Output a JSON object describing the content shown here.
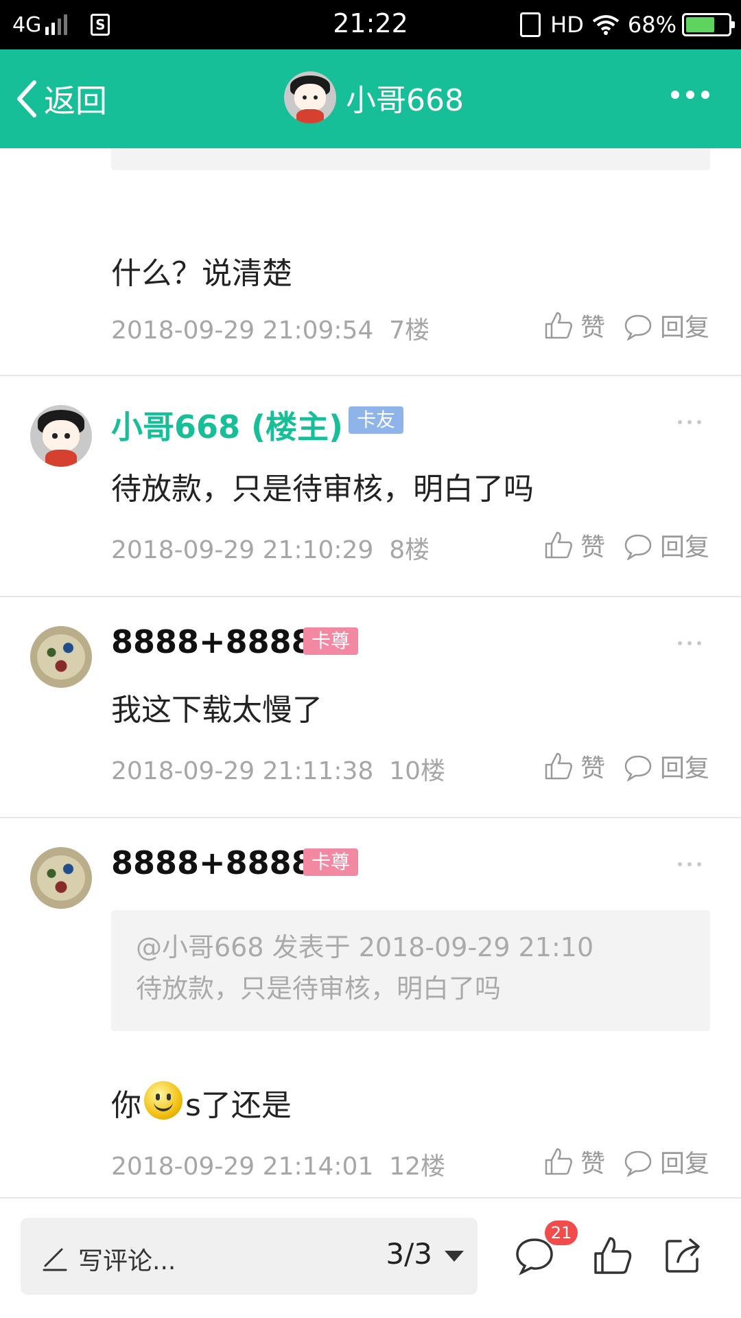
{
  "status_bar": {
    "network": "4G",
    "time": "21:22",
    "hd": "HD",
    "battery": "68%"
  },
  "header": {
    "back_label": "返回",
    "title": "小哥668"
  },
  "posts": [
    {
      "text": "什么？说清楚",
      "timestamp": "2018-09-29 21:09:54",
      "floor": "7楼",
      "like_label": "赞",
      "reply_label": "回复"
    },
    {
      "username": "小哥668 (楼主)",
      "badge": "卡友",
      "text": "待放款，只是待审核，明白了吗",
      "timestamp": "2018-09-29 21:10:29",
      "floor": "8楼",
      "like_label": "赞",
      "reply_label": "回复"
    },
    {
      "username": "8888+8888",
      "badge": "卡尊",
      "text": "我这下载太慢了",
      "timestamp": "2018-09-29 21:11:38",
      "floor": "10楼",
      "like_label": "赞",
      "reply_label": "回复"
    },
    {
      "username": "8888+8888",
      "badge": "卡尊",
      "quote_header": "@小哥668 发表于 2018-09-29 21:10",
      "quote_text": "待放款，只是待审核，明白了吗",
      "text_before": "你",
      "text_after": "s了还是",
      "timestamp": "2018-09-29 21:14:01",
      "floor": "12楼",
      "like_label": "赞",
      "reply_label": "回复"
    }
  ],
  "bottom_bar": {
    "placeholder": "写评论...",
    "page": "3/3",
    "comment_count": "21"
  },
  "colors": {
    "accent": "#17bf98",
    "badge_blue": "#8eb4ea",
    "badge_pink": "#f288a2",
    "notification": "#f24b4b"
  },
  "icons": [
    "back-chevron-icon",
    "more-icon",
    "thumb-up-icon",
    "speech-bubble-icon",
    "pencil-icon",
    "share-icon",
    "smiley-emoji"
  ]
}
